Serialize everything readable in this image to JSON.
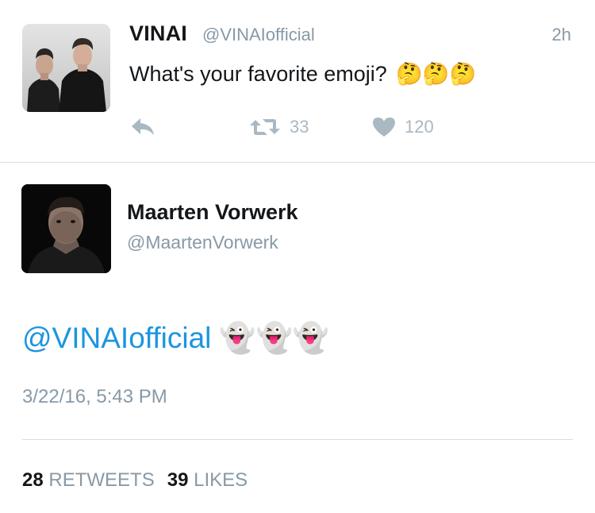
{
  "parent_tweet": {
    "author_name": "VINAI",
    "author_handle": "@VINAIofficial",
    "time_ago": "2h",
    "text": "What's your favorite emoji?",
    "emojis": "🤔🤔🤔",
    "retweet_count": "33",
    "like_count": "120",
    "avatar_icon": "avatar-photo"
  },
  "reply_tweet": {
    "author_name": "Maarten Vorwerk",
    "author_handle": "@MaartenVorwerk",
    "mention": "@VINAIofficial",
    "emojis": "👻👻👻",
    "timestamp": "3/22/16, 5:43 PM",
    "retweets": "28",
    "retweets_label": "RETWEETS",
    "likes": "39",
    "likes_label": "LIKES"
  },
  "colors": {
    "link": "#1b95e0",
    "secondary_text": "#8899a6",
    "action_icon": "#aab8c2",
    "divider": "#d8dde1"
  }
}
